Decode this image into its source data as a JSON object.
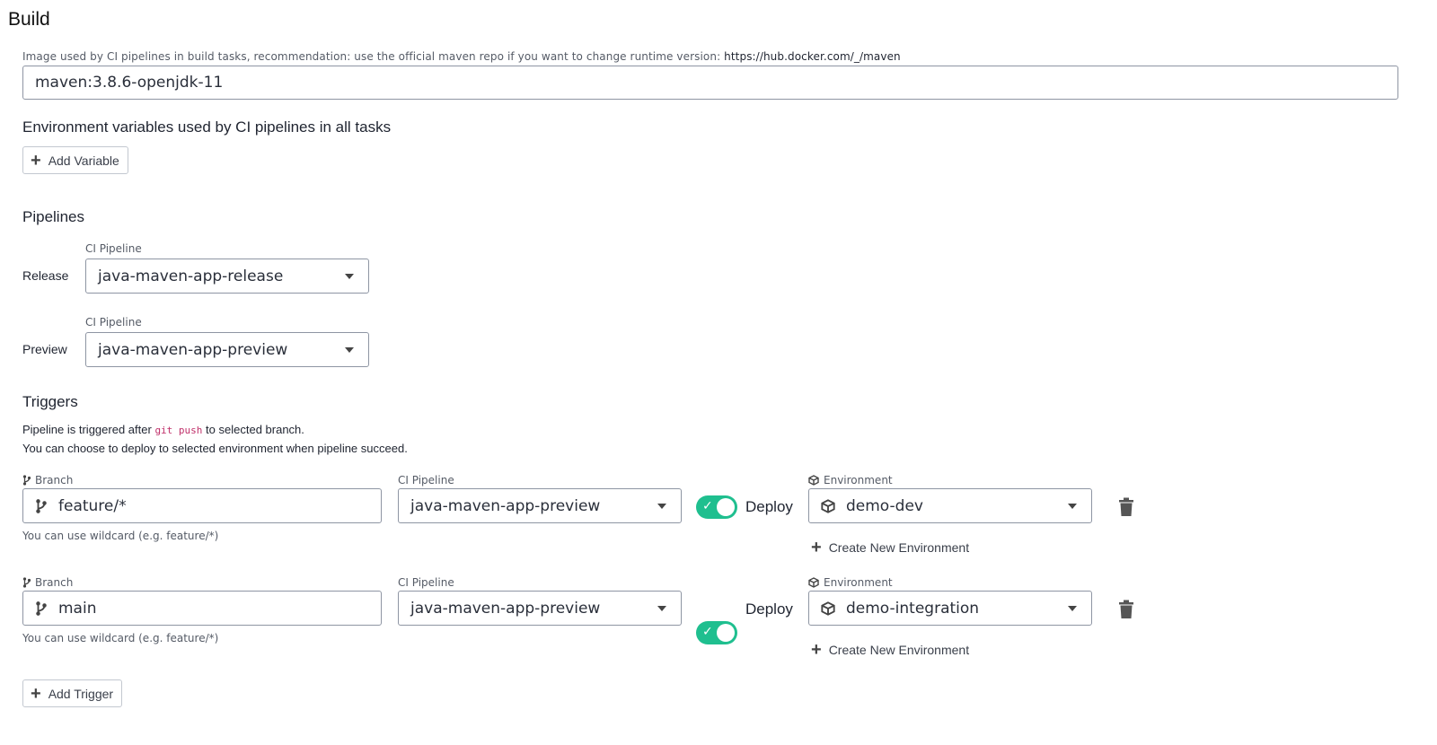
{
  "build": {
    "title": "Build",
    "image_hint": "Image used by CI pipelines in build tasks, recommendation: use the official maven repo if you want to change runtime version:",
    "image_hint_link": "https://hub.docker.com/_/maven",
    "image_value": "maven:3.8.6-openjdk-11",
    "env_title": "Environment variables used by CI pipelines in all tasks",
    "add_variable": "Add Variable"
  },
  "pipelines": {
    "title": "Pipelines",
    "rows": [
      {
        "label": "Release",
        "field_label": "CI Pipeline",
        "value": "java-maven-app-release"
      },
      {
        "label": "Preview",
        "field_label": "CI Pipeline",
        "value": "java-maven-app-preview"
      }
    ]
  },
  "triggers": {
    "title": "Triggers",
    "desc_pre": "Pipeline is triggered after",
    "desc_code": "git push",
    "desc_post": "to selected branch.",
    "desc_line2": "You can choose to deploy to selected environment when pipeline succeed.",
    "rows": [
      {
        "branch_label": "Branch",
        "branch_value": "feature/*",
        "branch_hint": "You can use wildcard (e.g. feature/*)",
        "pipeline_label": "CI Pipeline",
        "pipeline_value": "java-maven-app-preview",
        "deploy_label": "Deploy",
        "deploy_on": true,
        "env_label": "Environment",
        "env_value": "demo-dev",
        "create_env": "Create New Environment"
      },
      {
        "branch_label": "Branch",
        "branch_value": "main",
        "branch_hint": "You can use wildcard (e.g. feature/*)",
        "pipeline_label": "CI Pipeline",
        "pipeline_value": "java-maven-app-preview",
        "deploy_label": "Deploy",
        "deploy_on": true,
        "env_label": "Environment",
        "env_value": "demo-integration",
        "create_env": "Create New Environment"
      }
    ],
    "add_trigger": "Add Trigger"
  },
  "colors": {
    "toggle_on": "#1fbf8f",
    "code": "#c0306a"
  }
}
